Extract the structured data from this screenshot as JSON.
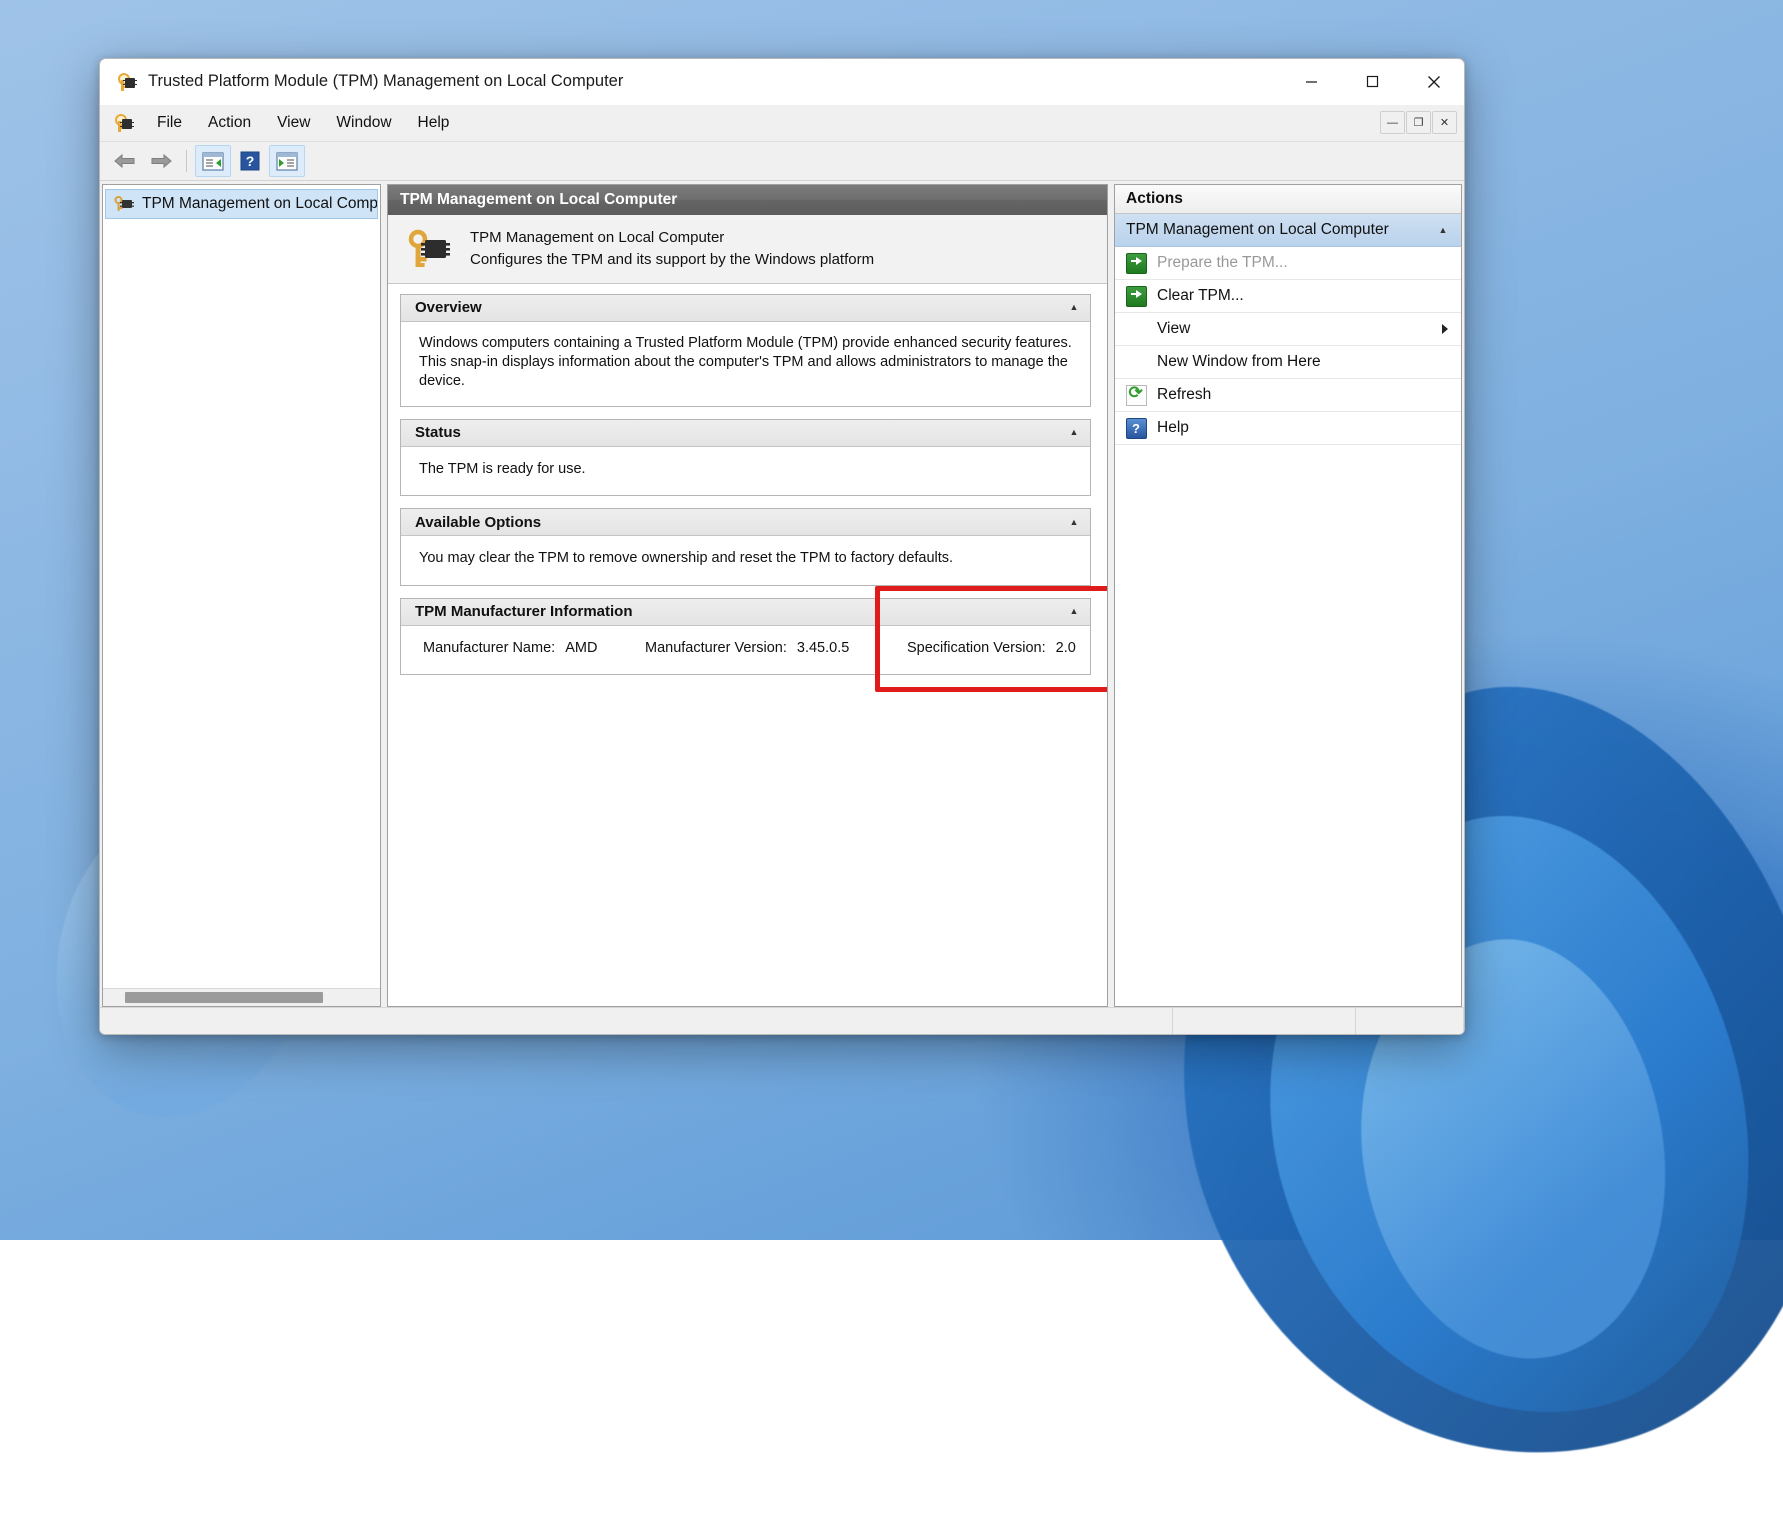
{
  "window": {
    "title": "Trusted Platform Module (TPM) Management on Local Computer",
    "title_icon": "tpm-key-chip-icon",
    "minimize_label": "Minimize",
    "maximize_label": "Maximize",
    "close_label": "Close"
  },
  "menubar": {
    "icon": "tpm-key-chip-icon",
    "items": [
      {
        "label": "File"
      },
      {
        "label": "Action"
      },
      {
        "label": "View"
      },
      {
        "label": "Window"
      },
      {
        "label": "Help"
      }
    ],
    "mdi_buttons": [
      {
        "name": "mdi-minimize",
        "glyph": "—"
      },
      {
        "name": "mdi-restore",
        "glyph": "❐"
      },
      {
        "name": "mdi-close",
        "glyph": "✕"
      }
    ]
  },
  "toolbar": {
    "buttons": [
      {
        "name": "back-button",
        "icon": "back-arrow-icon"
      },
      {
        "name": "forward-button",
        "icon": "forward-arrow-icon"
      },
      {
        "name": "show-hide-tree-button",
        "icon": "tree-pane-icon"
      },
      {
        "name": "help-button",
        "icon": "question-mark-icon"
      },
      {
        "name": "show-hide-action-pane-button",
        "icon": "action-pane-icon"
      }
    ]
  },
  "tree": {
    "items": [
      {
        "label": "TPM Management on Local Compu",
        "icon": "tpm-node-icon",
        "selected": true
      }
    ]
  },
  "content": {
    "header": "TPM Management on Local Computer",
    "intro": {
      "icon": "tpm-key-chip-large-icon",
      "title": "TPM Management on Local Computer",
      "subtitle": "Configures the TPM and its support by the Windows platform"
    },
    "sections": [
      {
        "name": "overview",
        "title": "Overview",
        "collapse_glyph": "▲",
        "body": "Windows computers containing a Trusted Platform Module (TPM) provide enhanced security features. This snap-in displays information about the computer's TPM and allows administrators to manage the device."
      },
      {
        "name": "status",
        "title": "Status",
        "collapse_glyph": "▲",
        "body": "The TPM is ready for use."
      },
      {
        "name": "available-options",
        "title": "Available Options",
        "collapse_glyph": "▲",
        "body": "You may clear the TPM to remove ownership and reset the TPM to factory defaults."
      }
    ],
    "manufacturer_section": {
      "name": "tpm-manufacturer-information",
      "title": "TPM Manufacturer Information",
      "collapse_glyph": "▲",
      "fields": [
        {
          "label": "Manufacturer Name:",
          "value": "AMD"
        },
        {
          "label": "Manufacturer Version:",
          "value": "3.45.0.5"
        },
        {
          "label": "Specification Version:",
          "value": "2.0"
        }
      ]
    }
  },
  "actions": {
    "header": "Actions",
    "group": {
      "label": "TPM Management on Local Computer",
      "collapse_glyph": "▲"
    },
    "items": [
      {
        "label": "Prepare the TPM...",
        "icon": "green-arrow-icon",
        "disabled": true,
        "submenu": false
      },
      {
        "label": "Clear TPM...",
        "icon": "green-arrow-icon",
        "disabled": false,
        "submenu": false
      },
      {
        "label": "View",
        "icon": "none",
        "disabled": false,
        "submenu": true
      },
      {
        "label": "New Window from Here",
        "icon": "none",
        "disabled": false,
        "submenu": false
      },
      {
        "label": "Refresh",
        "icon": "refresh-icon",
        "disabled": false,
        "submenu": false
      },
      {
        "label": "Help",
        "icon": "help-question-icon",
        "disabled": false,
        "submenu": false
      }
    ]
  },
  "highlight": {
    "name": "specification-version-highlight",
    "color": "#e01b1b"
  },
  "colors": {
    "accent_selection": "#cfe4f7",
    "header_gray": "#656565",
    "actions_group_blue": "#b9d2ec",
    "highlight_red": "#e01b1b",
    "green_icon": "#1f7a1f"
  }
}
